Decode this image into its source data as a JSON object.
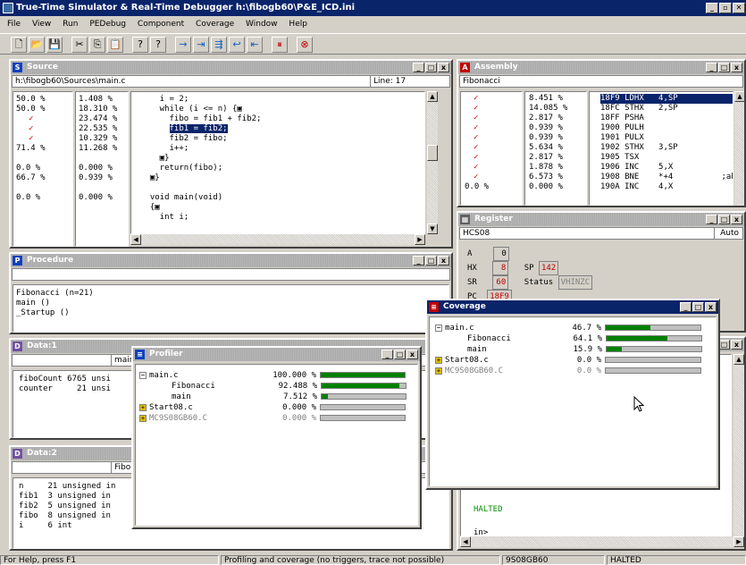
{
  "app": {
    "title": "True-Time Simulator & Real-Time Debugger   h:\\fibogb60\\P&E_ICD.ini",
    "menu": [
      "File",
      "View",
      "Run",
      "PEDebug",
      "Component",
      "Coverage",
      "Window",
      "Help"
    ]
  },
  "toolbar": {
    "icons": [
      "new-file-icon",
      "open-folder-icon",
      "save-icon",
      "cut-icon",
      "copy-icon",
      "paste-icon",
      "help-icon",
      "context-help-icon",
      "start-icon",
      "single-step-icon",
      "step-over-icon",
      "step-out-icon",
      "assembly-step-icon",
      "halt-icon",
      "reset-icon"
    ],
    "glyphs": [
      "🗋",
      "📂",
      "💾",
      "✂",
      "⎘",
      "📋",
      "?",
      "?",
      "→",
      "⇥",
      "⇶",
      "↩",
      "⇤",
      "⏸",
      "⊗"
    ]
  },
  "source": {
    "title": "Source",
    "path": "h:\\fibogb60\\Sources\\main.c",
    "line_label": "Line: 17",
    "col1": [
      "50.0 %",
      "50.0 %",
      "✓",
      "✓",
      "✓",
      "71.4 %",
      "",
      "0.0 %",
      "66.7 %",
      "",
      "0.0 %"
    ],
    "col2": [
      "1.408 %",
      "18.310 %",
      "23.474 %",
      "22.535 %",
      "10.329 %",
      "11.268 %",
      "",
      "0.000 %",
      "0.939 %",
      "",
      "0.000 %"
    ],
    "code": [
      "    i = 2;",
      "    while (i <= n) {▣",
      "      fibo = fib1 + fib2;",
      "      fib1 = fib2;",
      "      fib2 = fibo;",
      "      i++;",
      "    ▣}",
      "    return(fibo);",
      "  ▣}",
      "",
      "  void main(void)",
      "  {▣",
      "    int i;"
    ]
  },
  "assembly": {
    "title": "Assembly",
    "func": "Fibonacci",
    "pct": [
      "8.451 %",
      "14.085 %",
      "2.817 %",
      "0.939 %",
      "0.939 %",
      "5.634 %",
      "2.817 %",
      "1.878 %",
      "6.573 %",
      "0.000 %"
    ],
    "code": [
      "18F9 LDHX   4,SP",
      "18FC STHX   2,SP",
      "18FF PSHA",
      "1900 PULH",
      "1901 PULX",
      "1902 STHX   3,SP",
      "1905 TSX",
      "1906 INC    5,X",
      "1908 BNE    *+4          ;abs",
      "190A INC    4,X"
    ],
    "last_pct": "0.0 %"
  },
  "register": {
    "title": "Register",
    "cpu": "HCS08",
    "mode": "Auto",
    "A_label": "A",
    "A": "0",
    "HX_label": "HX",
    "HX": "8",
    "SP_label": "SP",
    "SP": "142",
    "SR_label": "SR",
    "SR": "60",
    "status_label": "Status",
    "status": "VHINZC",
    "PC_label": "PC",
    "PC": "18F9"
  },
  "procedure": {
    "title": "Procedure",
    "items": [
      "Fibonacci (n=21)",
      "main ()",
      "_Startup ()"
    ]
  },
  "data1": {
    "title": "Data:1",
    "scope": "main",
    "rows": [
      "fiboCount 6765 unsi",
      "counter     21 unsi"
    ]
  },
  "data2": {
    "title": "Data:2",
    "scope": "Fibo",
    "rows": [
      "n     21 unsigned in",
      "fib1  3 unsigned in",
      "fib2  5 unsigned in",
      "fibo  8 unsigned in",
      "i     6 int"
    ]
  },
  "command": {
    "halted": "HALTED",
    "prompt": "in>"
  },
  "profiler": {
    "title": "Profiler",
    "rows": [
      {
        "name": "main.c",
        "pct": "100.000 %",
        "fill": 1.0,
        "kind": "minus",
        "indent": 0
      },
      {
        "name": "Fibonacci",
        "pct": "92.488 %",
        "fill": 0.92488,
        "kind": "none",
        "indent": 2
      },
      {
        "name": "main",
        "pct": "7.512 %",
        "fill": 0.07512,
        "kind": "none",
        "indent": 2
      },
      {
        "name": "Start08.c",
        "pct": "0.000 %",
        "fill": 0,
        "kind": "plus",
        "indent": 0
      },
      {
        "name": "MC9S08GB60.C",
        "pct": "0.000 %",
        "fill": 0,
        "kind": "plus",
        "indent": 0,
        "gray": true
      }
    ]
  },
  "coverage": {
    "title": "Coverage",
    "rows": [
      {
        "name": "main.c",
        "pct": "46.7 %",
        "fill": 0.467,
        "kind": "minus",
        "indent": 0
      },
      {
        "name": "Fibonacci",
        "pct": "64.1 %",
        "fill": 0.641,
        "kind": "none",
        "indent": 2
      },
      {
        "name": "main",
        "pct": "15.9 %",
        "fill": 0.159,
        "kind": "none",
        "indent": 2
      },
      {
        "name": "Start08.c",
        "pct": "0.0 %",
        "fill": 0,
        "kind": "plus",
        "indent": 0
      },
      {
        "name": "MC9S08GB60.C",
        "pct": "0.0 %",
        "fill": 0,
        "kind": "plus",
        "indent": 0,
        "gray": true
      }
    ]
  },
  "statusbar": {
    "help": "For Help, press F1",
    "msg": "Profiling and coverage (no triggers, trace not possible)",
    "target": "9S08GB60",
    "state": "HALTED"
  },
  "colors": {
    "accent": "#0a246a",
    "bar_fill": "#008000",
    "check": "#d00000"
  }
}
